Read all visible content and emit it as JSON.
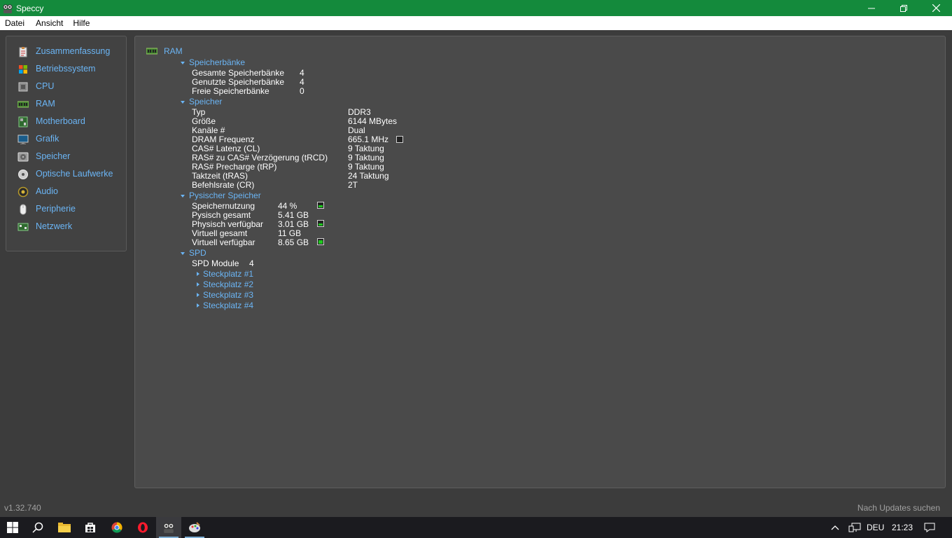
{
  "window": {
    "title": "Speccy",
    "minimize": "—",
    "maximize": "❐",
    "close": "✕"
  },
  "menu": [
    "Datei",
    "Ansicht",
    "Hilfe"
  ],
  "sidebar": {
    "items": [
      {
        "label": "Zusammenfassung",
        "icon": "clipboard-icon"
      },
      {
        "label": "Betriebssystem",
        "icon": "windows-logo-icon"
      },
      {
        "label": "CPU",
        "icon": "cpu-chip-icon"
      },
      {
        "label": "RAM",
        "icon": "ram-module-icon"
      },
      {
        "label": "Motherboard",
        "icon": "motherboard-icon"
      },
      {
        "label": "Grafik",
        "icon": "monitor-icon"
      },
      {
        "label": "Speicher",
        "icon": "hard-drive-icon"
      },
      {
        "label": "Optische Laufwerke",
        "icon": "disc-icon"
      },
      {
        "label": "Audio",
        "icon": "speaker-icon"
      },
      {
        "label": "Peripherie",
        "icon": "mouse-icon"
      },
      {
        "label": "Netzwerk",
        "icon": "network-icon"
      }
    ]
  },
  "main": {
    "heading": "RAM",
    "banks": {
      "title": "Speicherbänke",
      "rows": [
        {
          "label": "Gesamte Speicherbänke",
          "value": "4"
        },
        {
          "label": "Genutzte Speicherbänke",
          "value": "4"
        },
        {
          "label": "Freie Speicherbänke",
          "value": "0"
        }
      ]
    },
    "memory": {
      "title": "Speicher",
      "rows": [
        {
          "label": "Typ",
          "value": "DDR3"
        },
        {
          "label": "Größe",
          "value": "6144 MBytes"
        },
        {
          "label": "Kanäle #",
          "value": "Dual"
        },
        {
          "label": "DRAM Frequenz",
          "value": "665.1 MHz"
        },
        {
          "label": "CAS# Latenz (CL)",
          "value": "9 Taktung"
        },
        {
          "label": "RAS# zu CAS# Verzögerung (tRCD)",
          "value": "9 Taktung"
        },
        {
          "label": "RAS# Precharge (tRP)",
          "value": "9 Taktung"
        },
        {
          "label": "Taktzeit (tRAS)",
          "value": "24 Taktung"
        },
        {
          "label": "Befehlsrate (CR)",
          "value": "2T"
        }
      ]
    },
    "physical": {
      "title": "Pysischer Speicher",
      "rows": [
        {
          "label": "Speichernutzung",
          "value": "44 %"
        },
        {
          "label": "Pysisch gesamt",
          "value": "5.41 GB"
        },
        {
          "label": "Physisch verfügbar",
          "value": "3.01 GB"
        },
        {
          "label": "Virtuell gesamt",
          "value": "11 GB"
        },
        {
          "label": "Virtuell verfügbar",
          "value": "8.65 GB"
        }
      ]
    },
    "spd": {
      "title": "SPD",
      "modules_label": "SPD Module",
      "modules_value": "4",
      "slots": [
        "Steckplatz #1",
        "Steckplatz #2",
        "Steckplatz #3",
        "Steckplatz #4"
      ]
    },
    "gauges": {
      "dram_frequency_fraction": 0.0,
      "memory_usage_fraction": 0.44,
      "physical_available_fraction": 0.56,
      "virtual_available_fraction": 0.79
    }
  },
  "status": {
    "version": "v1.32.740",
    "updates": "Nach Updates suchen"
  },
  "taskbar": {
    "language": "DEU",
    "time": "21:23"
  },
  "colors": {
    "titlebar": "#148a3c",
    "link": "#6bb5f5",
    "panel": "#4a4a4a",
    "gauge_fill": "#1ec81e"
  }
}
